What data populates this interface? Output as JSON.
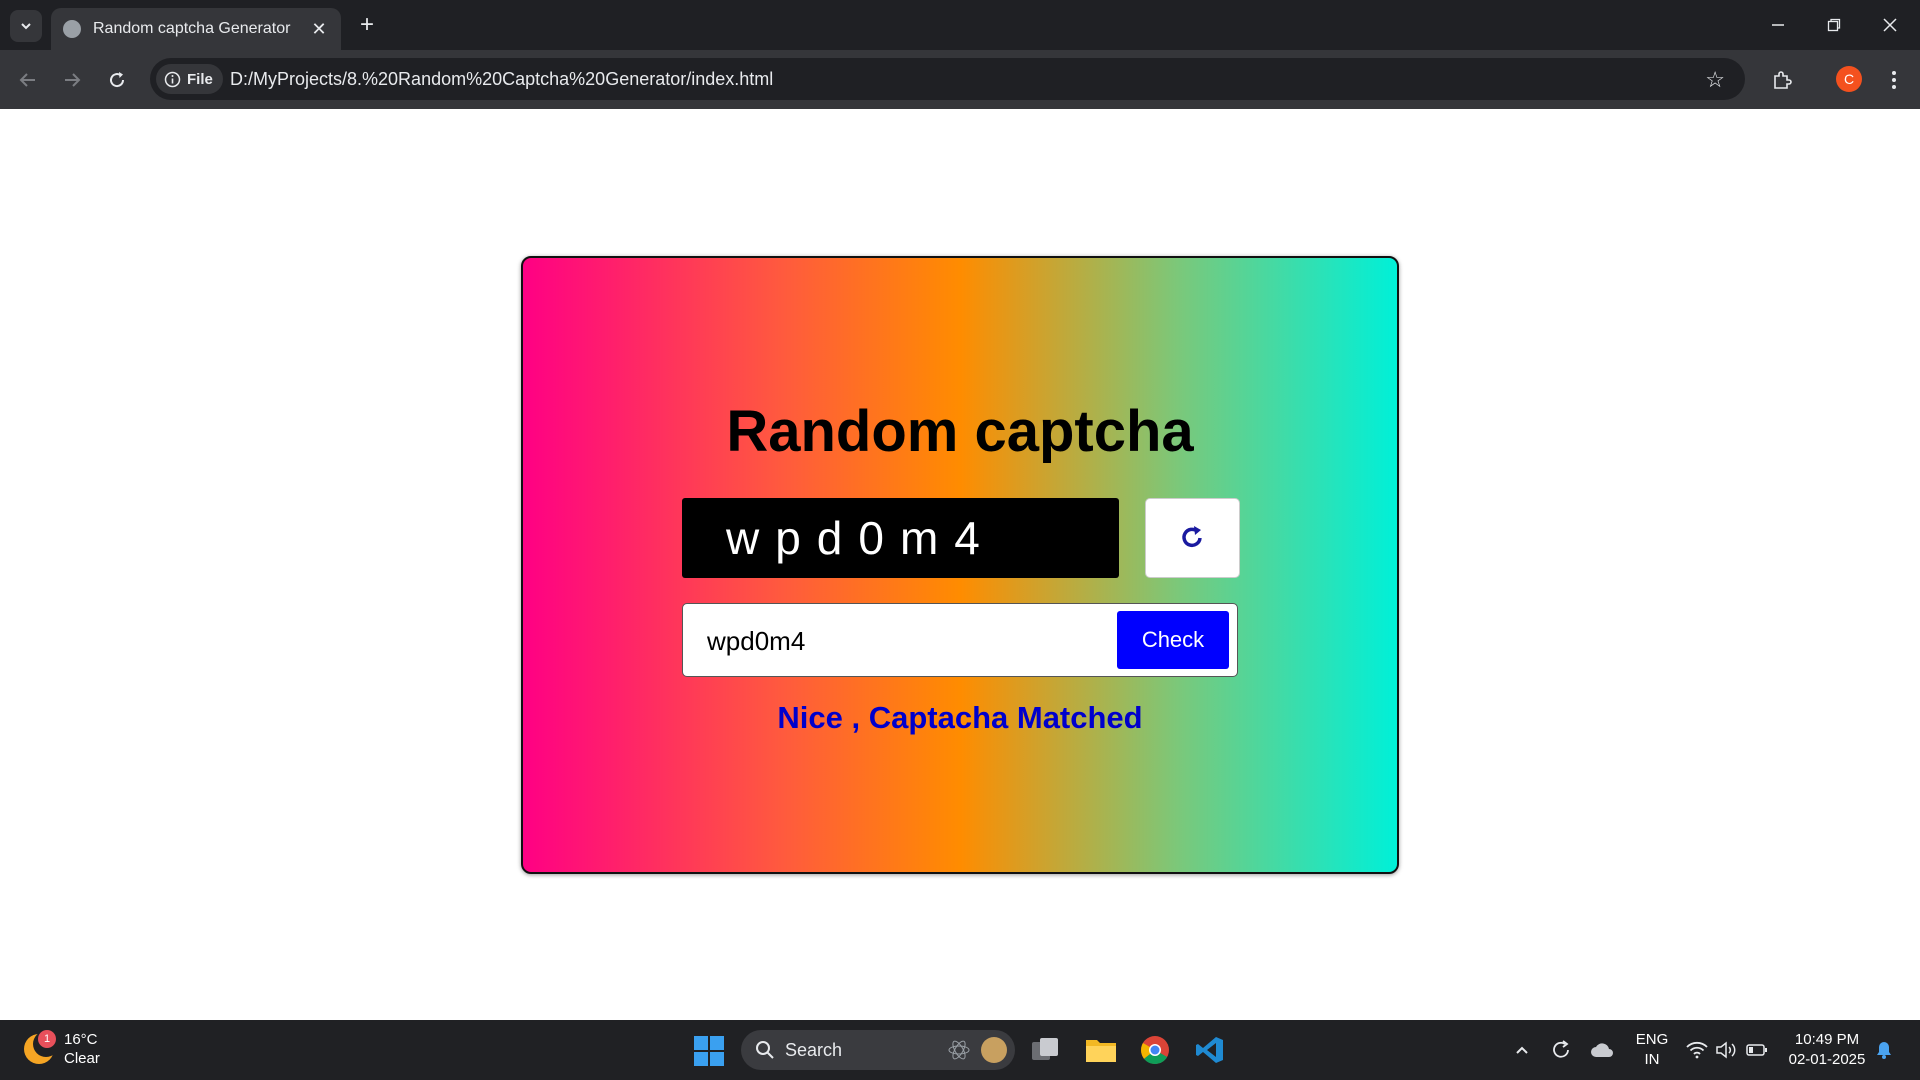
{
  "browser": {
    "tab_title": "Random captcha Generator",
    "new_tab_symbol": "+",
    "site_info_label": "File",
    "url": "D:/MyProjects/8.%20Random%20Captcha%20Generator/index.html",
    "profile_initial": "C"
  },
  "page": {
    "heading": "Random captcha",
    "captcha_display": "wpd0m4",
    "input_value": "wpd0m4",
    "check_label": "Check",
    "result_message": "Nice , Captacha Matched"
  },
  "taskbar": {
    "weather_badge": "1",
    "temperature": "16°C",
    "condition": "Clear",
    "search_label": "Search",
    "language_line1": "ENG",
    "language_line2": "IN",
    "time": "10:49 PM",
    "date": "02-01-2025"
  },
  "colors": {
    "check_button": "#0000ff",
    "message": "#0000cc",
    "gradient_start": "#ff0084",
    "gradient_mid": "#ff8c00",
    "gradient_end": "#00f0d8"
  }
}
